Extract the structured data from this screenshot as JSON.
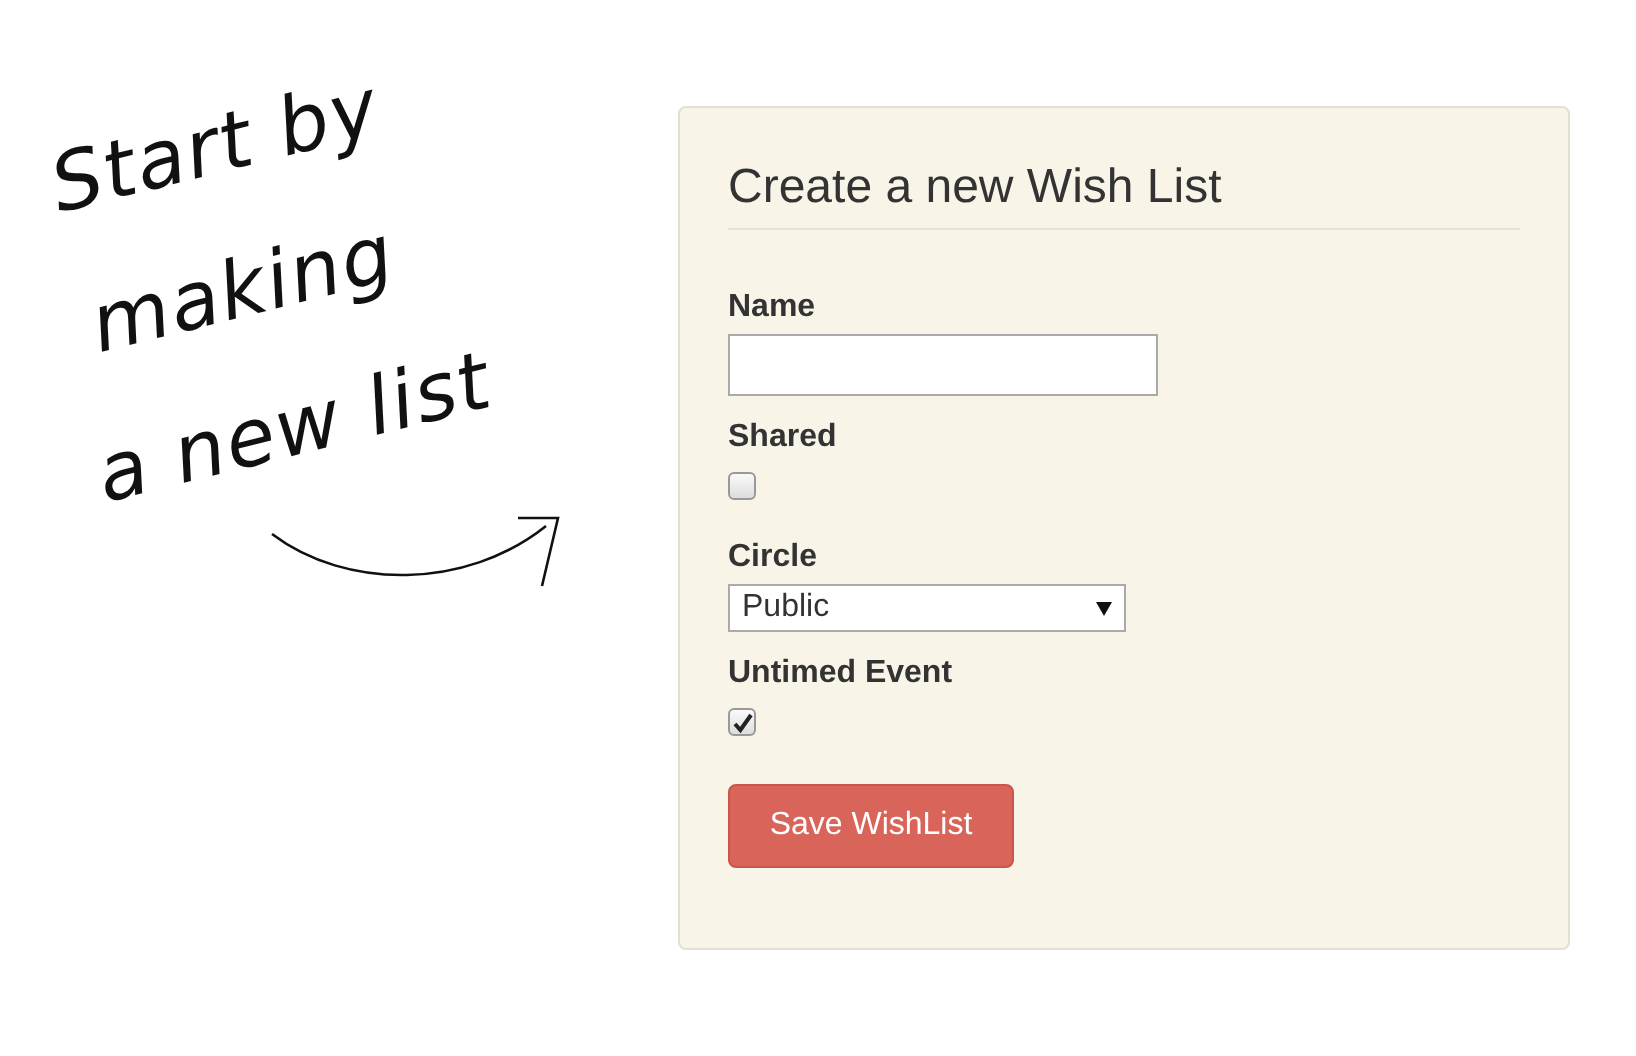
{
  "annotation": {
    "lines": [
      "Start by",
      "making",
      "a new list"
    ]
  },
  "form": {
    "title": "Create a new Wish List",
    "fields": [
      {
        "kind": "text",
        "label": "Name"
      },
      {
        "kind": "checkbox",
        "label": "Shared",
        "checked": false
      },
      {
        "kind": "select",
        "label": "Circle",
        "value": "Public"
      },
      {
        "kind": "checkbox",
        "label": "Untimed Event",
        "checked": true
      }
    ],
    "submit": "Save WishList"
  }
}
